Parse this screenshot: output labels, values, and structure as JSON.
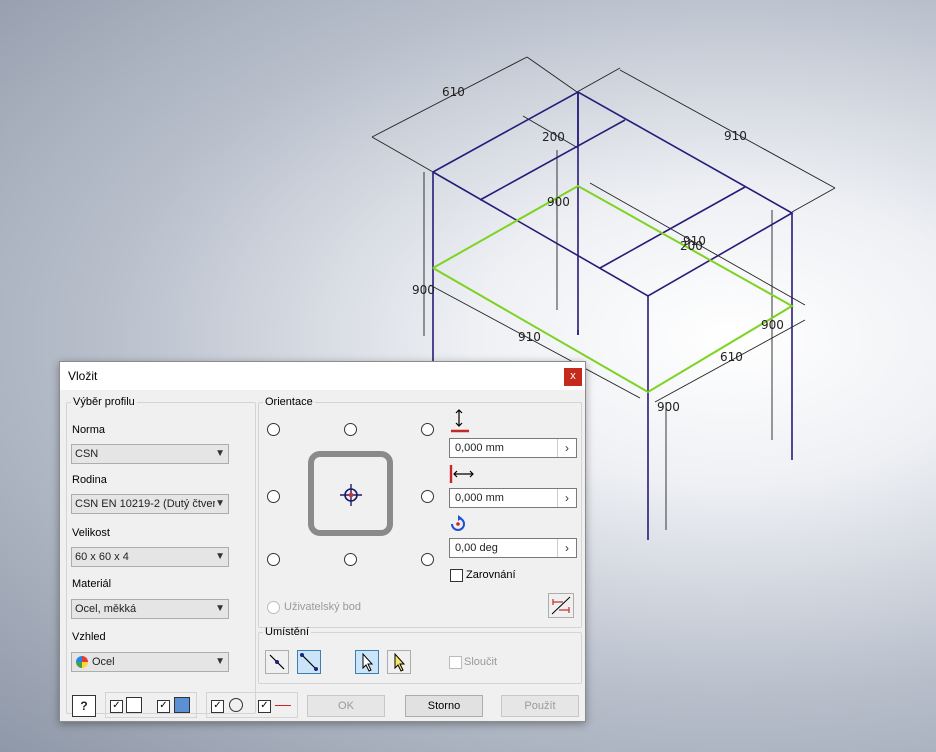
{
  "drawing": {
    "dimensions": [
      "610",
      "910",
      "200",
      "900",
      "910",
      "200",
      "900",
      "910",
      "900",
      "900",
      "610",
      "900"
    ]
  },
  "dialog": {
    "title": "Vložit",
    "close_label": "x",
    "profile_group": {
      "legend": "Výběr profilu",
      "norma_label": "Norma",
      "norma_value": "CSN",
      "rodina_label": "Rodina",
      "rodina_value": "CSN EN 10219-2 (Dutý čtver",
      "velikost_label": "Velikost",
      "velikost_value": "60 x 60 x 4",
      "material_label": "Materiál",
      "material_value": "Ocel, měkká",
      "vzhled_label": "Vzhled",
      "vzhled_value": "Ocel"
    },
    "orientation_group": {
      "legend": "Orientace",
      "offset_y": "0,000 mm",
      "offset_x": "0,000 mm",
      "rotation": "0,00 deg",
      "zarovnani_label": "Zarovnání",
      "user_point_label": "Uživatelský bod"
    },
    "placement_group": {
      "legend": "Umístění",
      "merge_label": "Sloučit"
    },
    "buttons": {
      "ok": "OK",
      "storno": "Storno",
      "pouzit": "Použít",
      "help": "?"
    },
    "colors": {
      "accent": "#3c7fb1",
      "close": "#c42b1c",
      "frame_line": "#2a1a7a",
      "selected_line": "#7ed321"
    }
  }
}
